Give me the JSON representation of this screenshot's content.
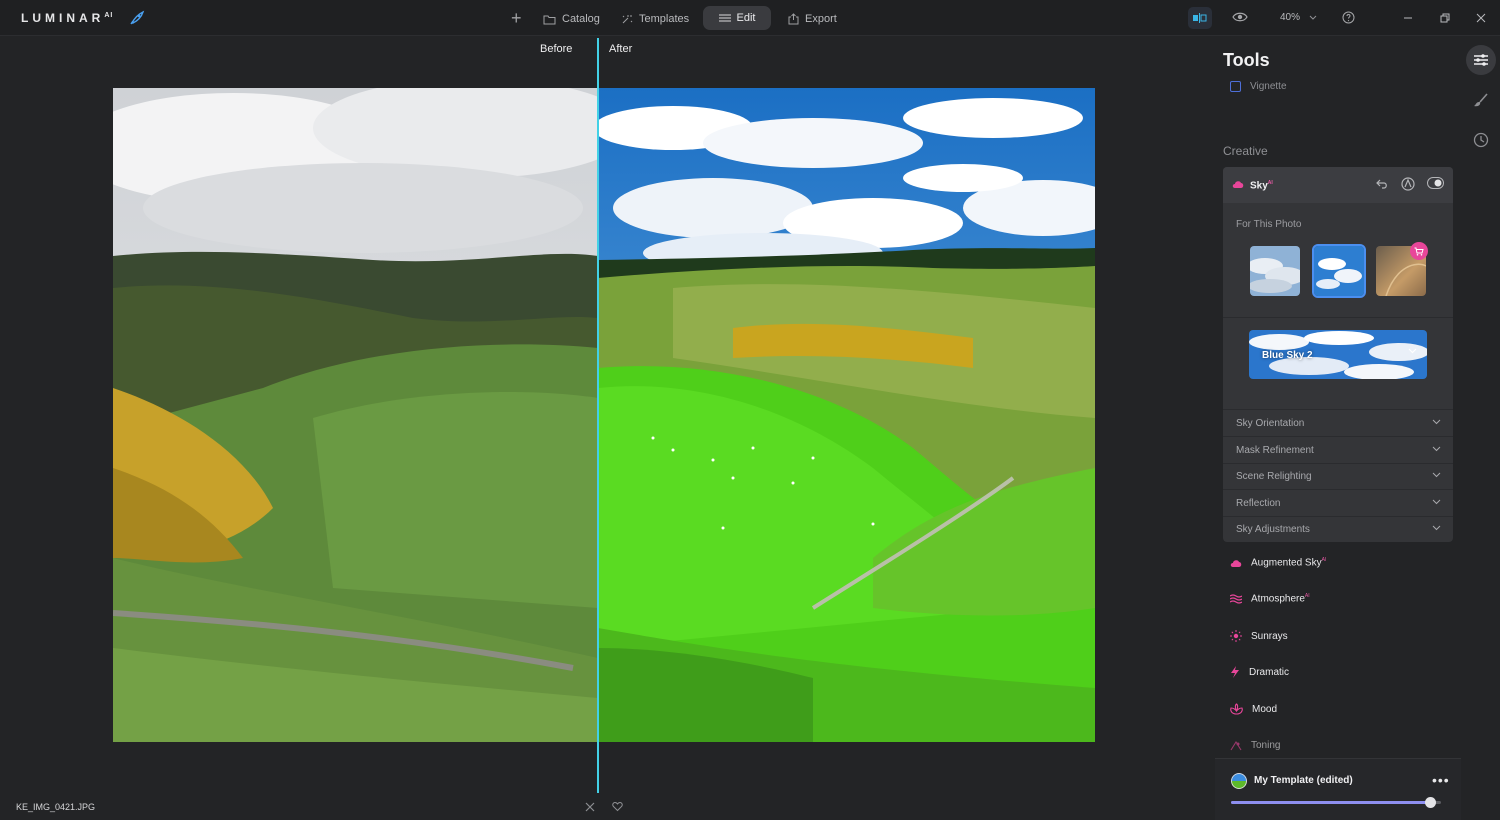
{
  "app": {
    "logo": "LUMINAR",
    "logo_suffix": "AI"
  },
  "topbar": {
    "catalog": "Catalog",
    "templates": "Templates",
    "edit": "Edit",
    "export": "Export",
    "zoom": "40%"
  },
  "canvas": {
    "before_label": "Before",
    "after_label": "After",
    "filename": "KE_IMG_0421.JPG",
    "split_position": 0.49
  },
  "panel": {
    "title": "Tools",
    "vignette": "Vignette",
    "section": "Creative",
    "sky": {
      "name": "Sky",
      "ai_badge": "AI",
      "for_this_photo": "For This Photo",
      "selected_sky": "Blue Sky 2",
      "accordions": [
        "Sky Orientation",
        "Mask Refinement",
        "Scene Relighting",
        "Reflection",
        "Sky Adjustments"
      ]
    },
    "tools": [
      {
        "label": "Augmented Sky",
        "ai": "AI"
      },
      {
        "label": "Atmosphere",
        "ai": "AI"
      },
      {
        "label": "Sunrays",
        "ai": ""
      },
      {
        "label": "Dramatic",
        "ai": ""
      },
      {
        "label": "Mood",
        "ai": ""
      },
      {
        "label": "Toning",
        "ai": ""
      }
    ]
  },
  "template": {
    "name": "My Template (edited)",
    "amount": 0.95
  },
  "colors": {
    "accent_pink": "#e8469a",
    "divider": "#43d1e6",
    "selection": "#4b8ff0"
  }
}
